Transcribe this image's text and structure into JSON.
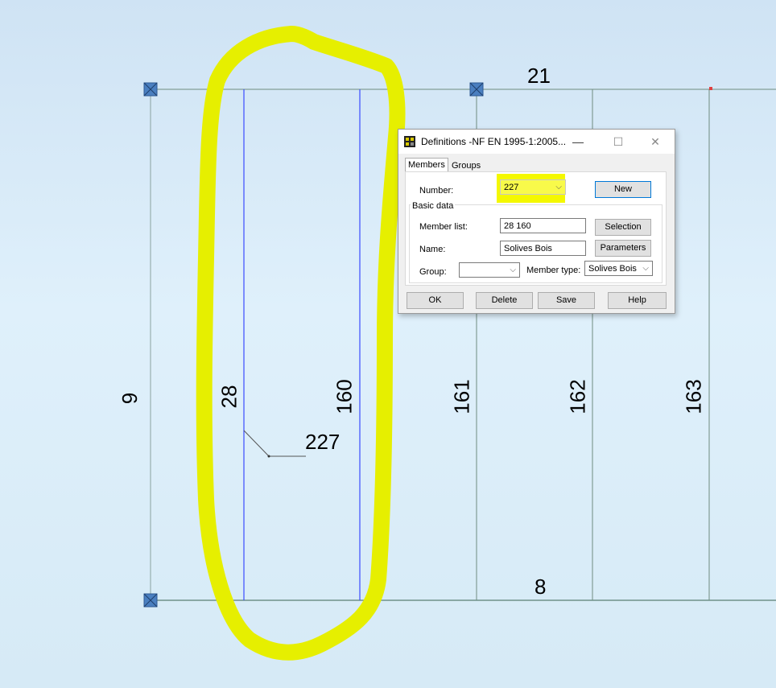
{
  "canvas": {
    "node_labels": {
      "top": "21",
      "bottom": "8",
      "left": "9"
    },
    "member_labels": [
      "28",
      "160",
      "161",
      "162",
      "163"
    ],
    "callout_label": "227",
    "colors": {
      "background_top": "#cfe3f4",
      "structure_line": "#5a7f74",
      "selected_member": "#3a4bff",
      "support_node": "#4a7fc0",
      "highlight": "#e6ef00"
    }
  },
  "dialog": {
    "title": "Definitions -NF EN 1995-1:2005...",
    "window_controls": {
      "minimize": "—",
      "maximize": "☐",
      "close": "✕"
    },
    "tabs": [
      "Members",
      "Groups"
    ],
    "number_label": "Number:",
    "number_value": "227",
    "new_button": "New",
    "basic_data_title": "Basic data",
    "member_list_label": "Member list:",
    "member_list_value": "28 160",
    "selection_button": "Selection",
    "name_label": "Name:",
    "name_value": "Solives Bois",
    "parameters_button": "Parameters",
    "group_label": "Group:",
    "group_value": "",
    "member_type_label": "Member type:",
    "member_type_value": "Solives Bois",
    "buttons": {
      "ok": "OK",
      "delete": "Delete",
      "save": "Save",
      "help": "Help"
    }
  }
}
